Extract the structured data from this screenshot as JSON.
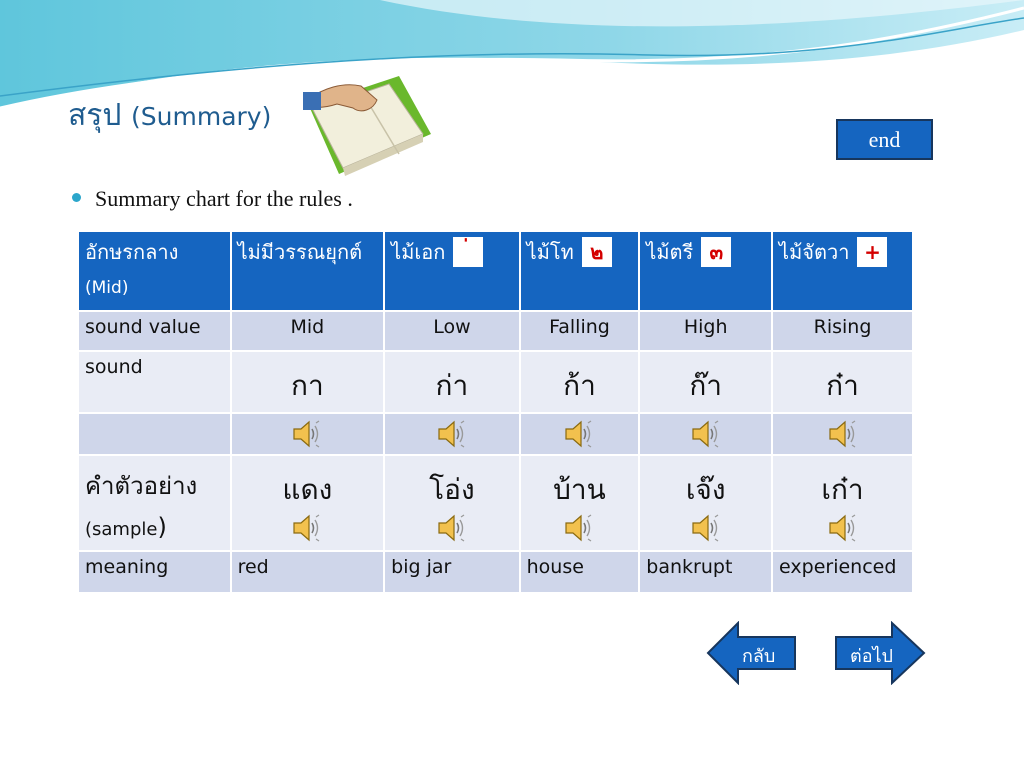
{
  "header": {
    "title_thai": "สรุป",
    "title_en": "(Summary)"
  },
  "end_button": "end",
  "bullet": "Summary chart for the rules .",
  "table": {
    "head": [
      {
        "main": "อักษรกลาง",
        "sub": "(Mid)"
      },
      {
        "main": "ไม่มีวรรณยุกต์"
      },
      {
        "main": "ไม้เอก",
        "mark": "่"
      },
      {
        "main": "ไม้โท",
        "mark": "๒"
      },
      {
        "main": "ไม้ตรี",
        "mark": "๓"
      },
      {
        "main": "ไม้จัตวา",
        "mark": "+"
      }
    ],
    "sound_value": {
      "label": "sound value",
      "cells": [
        "Mid",
        "Low",
        "Falling",
        "High",
        "Rising"
      ]
    },
    "sound": {
      "label": "sound",
      "cells": [
        "กา",
        "ก่า",
        "ก้า",
        "ก๊า",
        "ก๋า"
      ]
    },
    "sample": {
      "label_thai": "คำตัวอย่าง",
      "label_en": "(sample",
      "label_paren": ")",
      "cells": [
        "แดง",
        "โอ่ง",
        "บ้าน",
        "เจ๊ง",
        "เก๋า"
      ]
    },
    "meaning": {
      "label": "meaning",
      "cells": [
        "red",
        "big jar",
        "house",
        "bankrupt",
        "experienced"
      ]
    }
  },
  "nav": {
    "back": "กลับ",
    "next": "ต่อไป"
  },
  "icons": {
    "speaker": "speaker-icon",
    "book": "book-icon"
  },
  "colors": {
    "header_bg": "#1565c0",
    "row_dark": "#cfd6ea",
    "row_light": "#e9ecf5"
  }
}
